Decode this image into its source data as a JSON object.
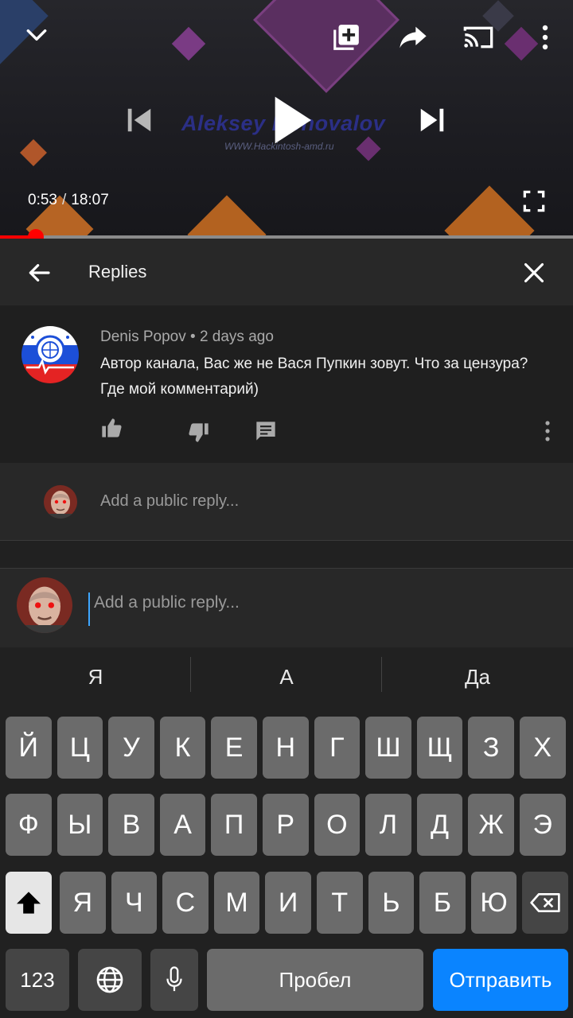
{
  "player": {
    "watermark_title": "Aleksey Konovalov",
    "watermark_url": "WWW.Hackintosh-amd.ru",
    "current_time": "0:53",
    "separator": "/",
    "duration": "18:07",
    "progress_fraction": 0.062,
    "is_paused": true
  },
  "replies": {
    "title": "Replies"
  },
  "comment": {
    "author": "Denis Popov",
    "dot": "•",
    "age": "2 days ago",
    "text": "Автор канала, Вас же не Вася Пупкин зовут. Что за цензура? Где мой комментарий)"
  },
  "reply_row": {
    "placeholder": "Add a public reply..."
  },
  "composer": {
    "placeholder": "Add a public reply..."
  },
  "keyboard": {
    "suggestions": [
      "Я",
      "А",
      "Да"
    ],
    "row1": [
      "Й",
      "Ц",
      "У",
      "К",
      "Е",
      "Н",
      "Г",
      "Ш",
      "Щ",
      "З",
      "Х"
    ],
    "row2": [
      "Ф",
      "Ы",
      "В",
      "А",
      "П",
      "Р",
      "О",
      "Л",
      "Д",
      "Ж",
      "Э"
    ],
    "row3": [
      "Я",
      "Ч",
      "С",
      "М",
      "И",
      "Т",
      "Ь",
      "Б",
      "Ю"
    ],
    "numbers_key": "123",
    "space_key": "Пробел",
    "send_key": "Отправить"
  },
  "colors": {
    "progress": "#ff0000",
    "send_key": "#0a84ff",
    "cursor": "#3ea6ff"
  }
}
